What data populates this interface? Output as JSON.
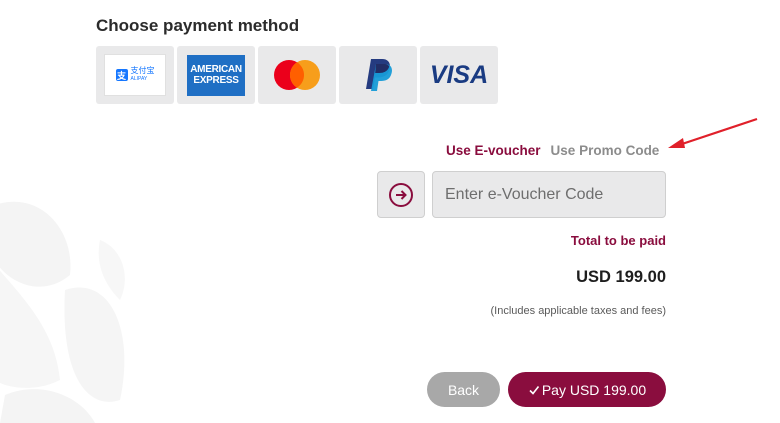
{
  "title": "Choose payment method",
  "payment_methods": [
    {
      "name": "alipay",
      "logo_text": "支付宝",
      "sub_text": "ALIPAY",
      "icon": "alipay-icon"
    },
    {
      "name": "amex",
      "line1": "AMERICAN",
      "line2": "EXPRESS",
      "icon": "amex-icon"
    },
    {
      "name": "mastercard",
      "icon": "mastercard-icon"
    },
    {
      "name": "paypal",
      "icon": "paypal-icon"
    },
    {
      "name": "visa",
      "logo_text": "VISA",
      "icon": "visa-icon"
    }
  ],
  "voucher_tabs": {
    "evoucher": "Use E-voucher",
    "promo": "Use Promo Code",
    "active": "evoucher"
  },
  "voucher_input": {
    "placeholder": "Enter e-Voucher Code",
    "value": ""
  },
  "submit_icon": "arrow-right-circle-icon",
  "total": {
    "label": "Total to be paid",
    "amount": "USD 199.00",
    "note": "(Includes applicable taxes and fees)"
  },
  "buttons": {
    "back": "Back",
    "pay": "Pay USD 199.00"
  },
  "colors": {
    "brand": "#8a0d3e",
    "card_bg": "#e9e9ea",
    "muted": "#8c8c8c",
    "back_button": "#a8a8a8",
    "annotation_arrow": "#e0202a"
  }
}
